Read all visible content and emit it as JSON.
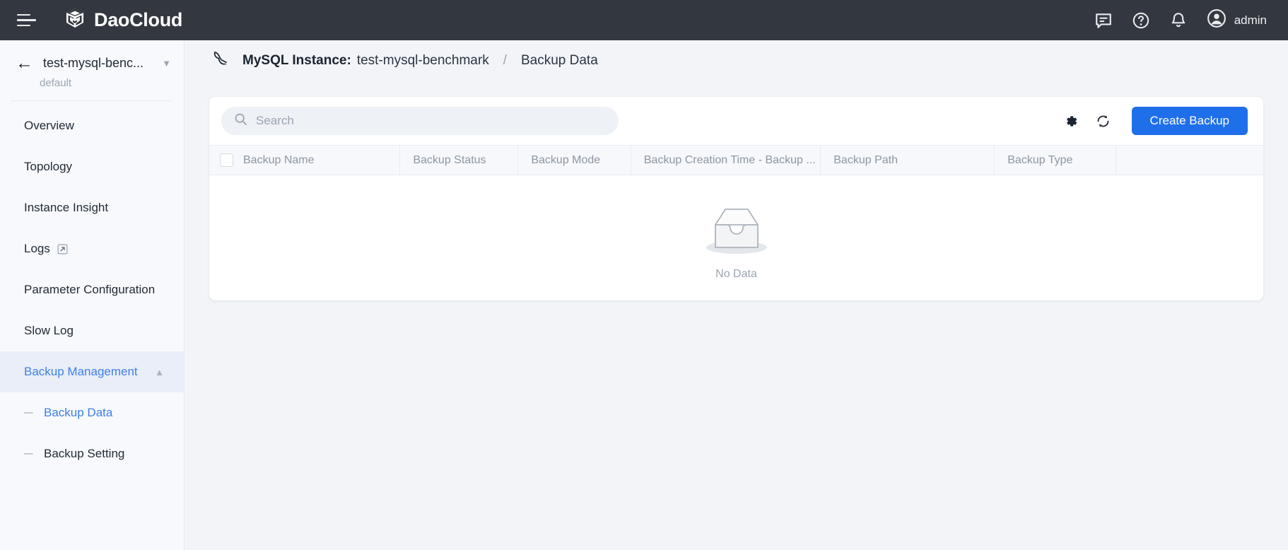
{
  "topbar": {
    "menu_icon": "hamburger-icon",
    "brand": "DaoCloud",
    "logo_icon": "daocloud-cube-logo",
    "icons": [
      {
        "name": "chat-icon",
        "label": "Chat"
      },
      {
        "name": "help-icon",
        "label": "Help"
      },
      {
        "name": "notification-bell-icon",
        "label": "Notifications"
      }
    ],
    "user": "admin",
    "avatar_icon": "user-avatar-icon"
  },
  "sidebar": {
    "back_icon": "back-arrow-icon",
    "instance_name": "test-mysql-benc...",
    "instance_namespace": "default",
    "dropdown_icon": "chevron-down-icon",
    "items": [
      {
        "label": "Overview",
        "active": false,
        "external": false
      },
      {
        "label": "Topology",
        "active": false,
        "external": false
      },
      {
        "label": "Instance Insight",
        "active": false,
        "external": false
      },
      {
        "label": "Logs",
        "active": false,
        "external": true
      },
      {
        "label": "Parameter Configuration",
        "active": false,
        "external": false
      },
      {
        "label": "Slow Log",
        "active": false,
        "external": false
      }
    ],
    "group": {
      "label": "Backup Management",
      "active": true,
      "collapse_icon": "chevron-up-icon",
      "children": [
        {
          "label": "Backup Data",
          "active": true
        },
        {
          "label": "Backup Setting",
          "active": false
        }
      ]
    }
  },
  "breadcrumb": {
    "db_icon": "mysql-dolphin-icon",
    "label": "MySQL Instance:",
    "instance": "test-mysql-benchmark",
    "separator": "/",
    "current": "Backup Data"
  },
  "toolbar": {
    "search_placeholder": "Search",
    "search_value": "",
    "search_icon": "search-icon",
    "settings_icon": "gear-icon",
    "refresh_icon": "refresh-icon",
    "create_label": "Create Backup"
  },
  "table": {
    "select_all_checkbox": "select-all-checkbox",
    "columns": [
      "Backup Name",
      "Backup Status",
      "Backup Mode",
      "Backup Creation Time - Backup ...",
      "Backup Path",
      "Backup Type",
      ""
    ],
    "rows": [],
    "empty_text": "No Data",
    "empty_icon": "empty-inbox-icon"
  },
  "colors": {
    "topbar_bg": "#333840",
    "sidebar_bg": "#f7f9fc",
    "main_bg": "#f2f4f8",
    "accent": "#1f6feb",
    "active_text": "#3f7fe8",
    "active_bg": "#e9eef8"
  }
}
